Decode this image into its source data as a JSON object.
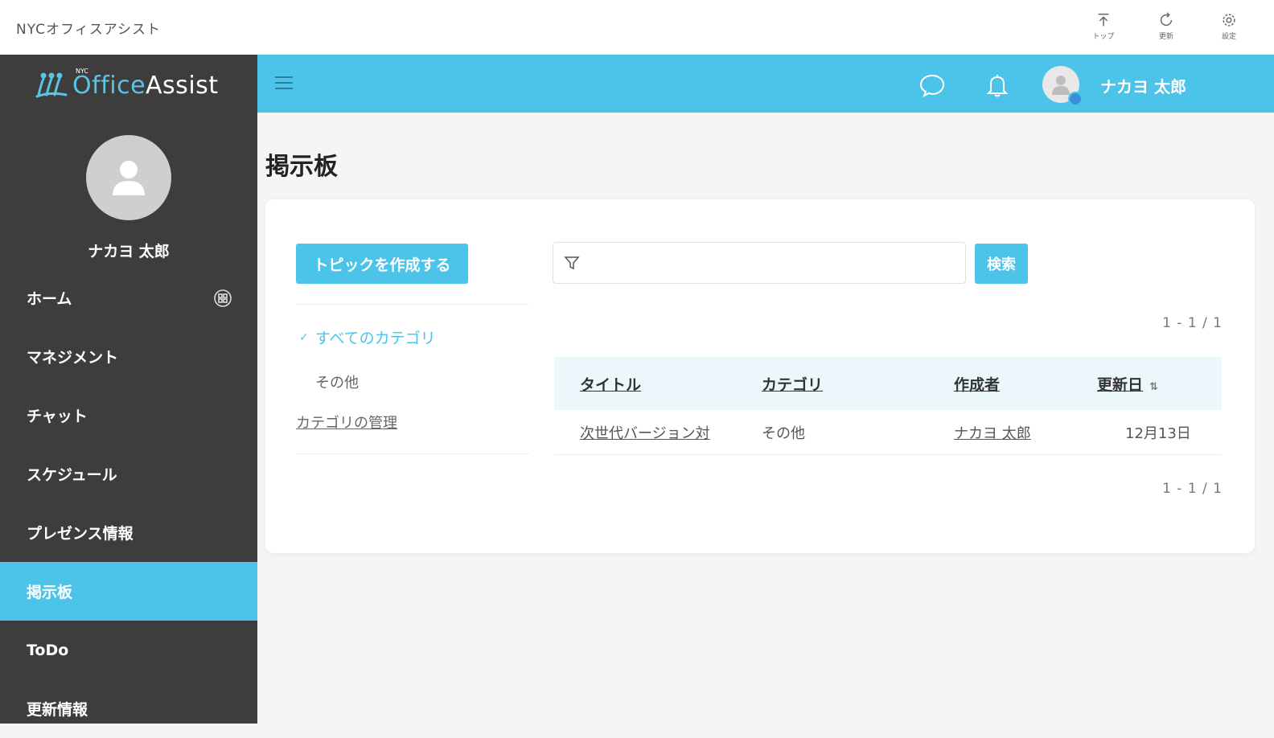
{
  "topbar": {
    "app_title": "NYCオフィスアシスト",
    "buttons": [
      {
        "label": "トップ",
        "icon": "top-icon"
      },
      {
        "label": "更新",
        "icon": "refresh-icon"
      },
      {
        "label": "設定",
        "icon": "settings-icon"
      }
    ]
  },
  "sidebar": {
    "logo_small": "NYC",
    "logo_office": "Office",
    "logo_assist": "Assist",
    "user_name": "ナカヨ 太郎",
    "items": [
      {
        "label": "ホーム"
      },
      {
        "label": "マネジメント"
      },
      {
        "label": "チャット"
      },
      {
        "label": "スケジュール"
      },
      {
        "label": "プレゼンス情報"
      },
      {
        "label": "掲示板",
        "active": true
      },
      {
        "label": "ToDo"
      },
      {
        "label": "更新情報"
      }
    ]
  },
  "header": {
    "user_name": "ナカヨ 太郎",
    "accent": "#4cc3e8"
  },
  "main": {
    "page_title": "掲示板",
    "create_button": "トピックを作成する",
    "search_placeholder": "",
    "search_value": "",
    "search_button": "検索",
    "pager_top": "1 - 1 / 1",
    "pager_bottom": "1 - 1 / 1",
    "categories": {
      "all": "すべてのカテゴリ",
      "other": "その他",
      "manage": "カテゴリの管理"
    },
    "table": {
      "headers": {
        "title": "タイトル",
        "category": "カテゴリ",
        "author": "作成者",
        "updated": "更新日"
      },
      "rows": [
        {
          "title": "次世代バージョン対",
          "category": "その他",
          "author": "ナカヨ 太郎",
          "updated": "12月13日"
        }
      ]
    }
  }
}
